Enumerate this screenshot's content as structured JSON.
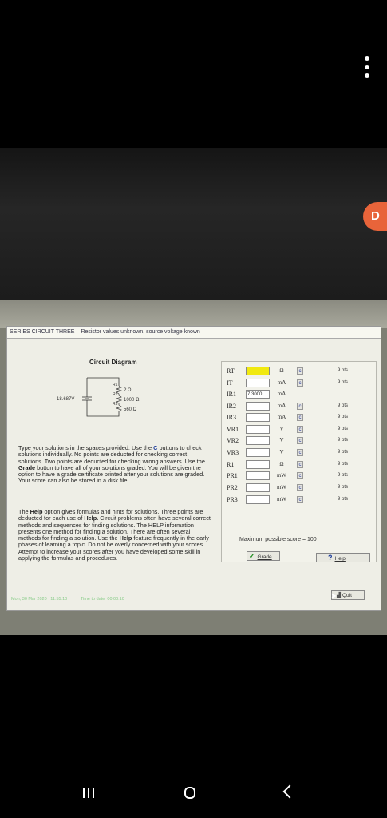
{
  "window": {
    "title": "SERIES CIRCUIT THREE",
    "subtitle": "Resistor values unknown, source voltage known"
  },
  "circuit": {
    "title": "Circuit Diagram",
    "source_voltage": "18.687V",
    "r1_label": "R1",
    "r1_value": "? Ω",
    "r2_label": "R2",
    "r2_value": "1000 Ω",
    "r3_label": "R3",
    "r3_value": "560 Ω"
  },
  "instructions": {
    "p1_before": "Type your solutions in the spaces provided. Use the ",
    "p1_c": "C",
    "p1_after": " buttons to check solutions individually. No points are deducted for checking correct solutions. Two points are deducted for checking wrong answers. Use the ",
    "p1_grade": "Grade",
    "p1_end": " button to have all of your solutions graded. You will be given the option to have a grade certificate printed after your solutions are graded. Your score can also be stored in a disk file.",
    "p2_before": "The ",
    "p2_help": "Help",
    "p2_mid": " option gives formulas and hints for solutions. Three points are deducted for each use of ",
    "p2_help2": "Help.",
    "p2_mid2": " Circuit problems often have several correct methods and sequences for finding solutions. The HELP information presents one method for finding a solution. There are often several methods for finding a solution. Use the ",
    "p2_help3": "Help",
    "p2_end": " feature frequently in the early phases of learning a topic. Do not be overly concerned with your scores. Attempt to increase your scores after you have developed some skill in applying the formulas and procedures."
  },
  "rows": [
    {
      "label": "RT",
      "value": "",
      "unit": "Ω",
      "check": "c",
      "points": "9 pts",
      "highlight": true
    },
    {
      "label": "IT",
      "value": "",
      "unit": "mA",
      "check": "c",
      "points": "9 pts"
    },
    {
      "label": "IR1",
      "value": "7.3000",
      "unit": "mA",
      "check": "",
      "points": ""
    },
    {
      "label": "IR2",
      "value": "",
      "unit": "mA",
      "check": "c",
      "points": "9 pts"
    },
    {
      "label": "IR3",
      "value": "",
      "unit": "mA",
      "check": "c",
      "points": "9 pts"
    },
    {
      "label": "VR1",
      "value": "",
      "unit": "V",
      "check": "c",
      "points": "9 pts"
    },
    {
      "label": "VR2",
      "value": "",
      "unit": "V",
      "check": "c",
      "points": "9 pts"
    },
    {
      "label": "VR3",
      "value": "",
      "unit": "V",
      "check": "c",
      "points": "9 pts"
    },
    {
      "label": "R1",
      "value": "",
      "unit": "Ω",
      "check": "c",
      "points": "9 pts"
    },
    {
      "label": "PR1",
      "value": "",
      "unit": "mW",
      "check": "c",
      "points": "9 pts"
    },
    {
      "label": "PR2",
      "value": "",
      "unit": "mW",
      "check": "c",
      "points": "9 pts"
    },
    {
      "label": "PR3",
      "value": "",
      "unit": "mW",
      "check": "c",
      "points": "9 pts"
    }
  ],
  "max_score": "Maximum possible score = 100",
  "buttons": {
    "grade": "Grade",
    "help": "Help",
    "quit": "Quit"
  },
  "status": {
    "date": "Mon, 30 Mar 2020",
    "time": "11:55:10",
    "timer_label": "Time to date",
    "timer": "00:00:10"
  },
  "colors": {
    "highlight": "#f1e90f",
    "orange_badge": "#e8643a"
  }
}
